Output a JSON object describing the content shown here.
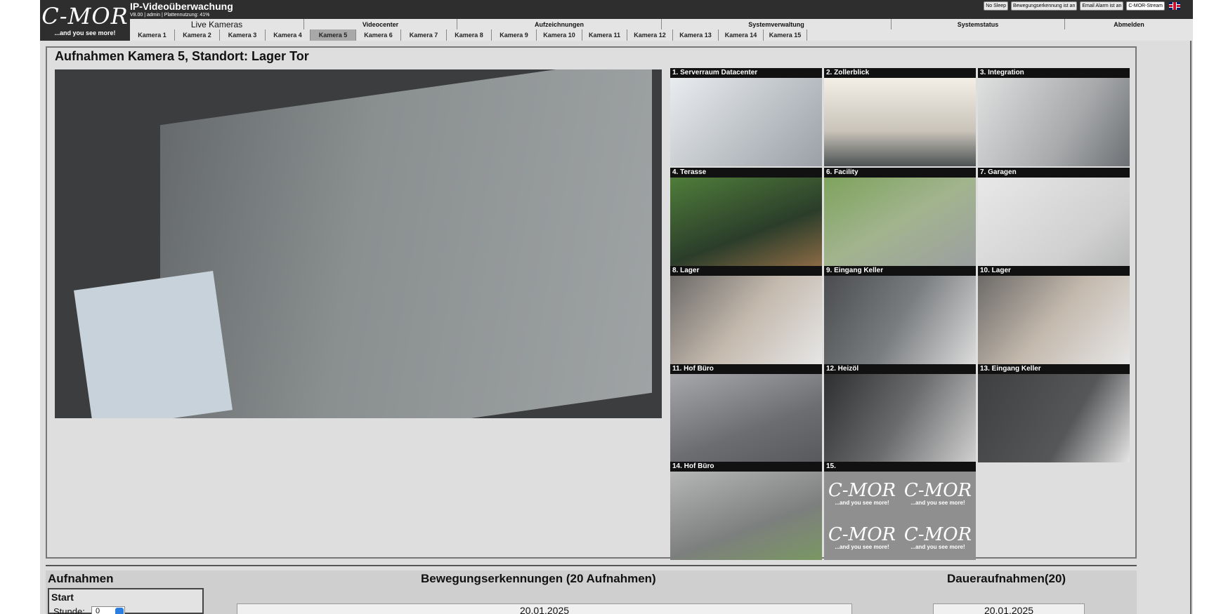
{
  "header": {
    "logo_mark": "C-MOR",
    "logo_tagline": "...and you see more!",
    "app_title": "IP-Videoüberwachung",
    "subtitle": "V8.00 | admin | Plattennutzung: 41%",
    "status_buttons": [
      "No Sleep",
      "Bewegungserkennung ist an",
      "Email Alarm ist an",
      "C-MOR-Stream"
    ],
    "flag_icon": "uk-flag-icon"
  },
  "nav": {
    "items": [
      "Live Kameras",
      "Videocenter",
      "Aufzeichnungen",
      "Systemverwaltung",
      "Systemstatus",
      "Abmelden"
    ]
  },
  "camera_tabs": [
    "Kamera 1",
    "Kamera 2",
    "Kamera 3",
    "Kamera 4",
    "Kamera 5",
    "Kamera 6",
    "Kamera 7",
    "Kamera 8",
    "Kamera 9",
    "Kamera 10",
    "Kamera 11",
    "Kamera 12",
    "Kamera 13",
    "Kamera 14",
    "Kamera 15"
  ],
  "active_camera_tab": "Kamera 5",
  "panel": {
    "title": "Aufnahmen Kamera 5, Standort: Lager Tor"
  },
  "thumbnails": [
    {
      "title": "1. Serverraum Datacenter"
    },
    {
      "title": "2. Zollerblick"
    },
    {
      "title": "3. Integration"
    },
    {
      "title": "4. Terasse"
    },
    {
      "title": "6. Facility"
    },
    {
      "title": "7. Garagen"
    },
    {
      "title": "8. Lager"
    },
    {
      "title": "9. Eingang Keller"
    },
    {
      "title": "10. Lager"
    },
    {
      "title": "11. Hof Büro"
    },
    {
      "title": "12. Heizöl"
    },
    {
      "title": "13. Eingang Keller"
    },
    {
      "title": "14. Hof Büro"
    },
    {
      "title": "15."
    }
  ],
  "placeholder_logo": {
    "mark": "C-MOR",
    "tagline": "...and you see more!"
  },
  "recordings": {
    "heading": "Aufnahmen",
    "start_label": "Start",
    "hour_label": "Stunde:",
    "hour_value": "0",
    "motion_heading": "Bewegungserkennungen (20 Aufnahmen)",
    "motion_date": "20.01.2025",
    "permanent_heading": "Daueraufnahmen(20)",
    "permanent_date": "20.01.2025"
  }
}
